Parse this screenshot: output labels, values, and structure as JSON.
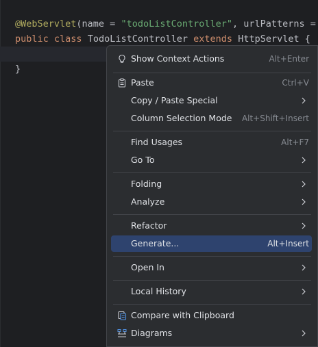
{
  "editor": {
    "line1": {
      "annotation": "@WebServlet",
      "p1": "(name = ",
      "name_value": "\"todoListController\"",
      "p2": ", urlPatterns ="
    },
    "line2": {
      "kw_public": "public",
      "kw_class": "class",
      "class_name": "TodoListController",
      "kw_extends": "extends",
      "parent": "HttpServlet {"
    },
    "line4": "}"
  },
  "menu": {
    "items": [
      {
        "label": "Show Context Actions",
        "shortcut": "Alt+Enter",
        "icon": "lightbulb-icon"
      },
      {
        "label": "Paste",
        "shortcut": "Ctrl+V",
        "icon": "clipboard-icon"
      },
      {
        "label": "Copy / Paste Special",
        "submenu": true
      },
      {
        "label": "Column Selection Mode",
        "shortcut": "Alt+Shift+Insert"
      },
      {
        "label": "Find Usages",
        "shortcut": "Alt+F7"
      },
      {
        "label": "Go To",
        "submenu": true
      },
      {
        "label": "Folding",
        "submenu": true
      },
      {
        "label": "Analyze",
        "submenu": true
      },
      {
        "label": "Refactor",
        "submenu": true
      },
      {
        "label": "Generate...",
        "shortcut": "Alt+Insert",
        "selected": true
      },
      {
        "label": "Open In",
        "submenu": true
      },
      {
        "label": "Local History",
        "submenu": true
      },
      {
        "label": "Compare with Clipboard",
        "icon": "compare-icon"
      },
      {
        "label": "Diagrams",
        "submenu": true,
        "icon": "diagram-icon"
      }
    ]
  },
  "colors": {
    "selection": "#2e436e",
    "menu_bg": "#2b2d30",
    "editor_bg": "#1e1f22"
  }
}
